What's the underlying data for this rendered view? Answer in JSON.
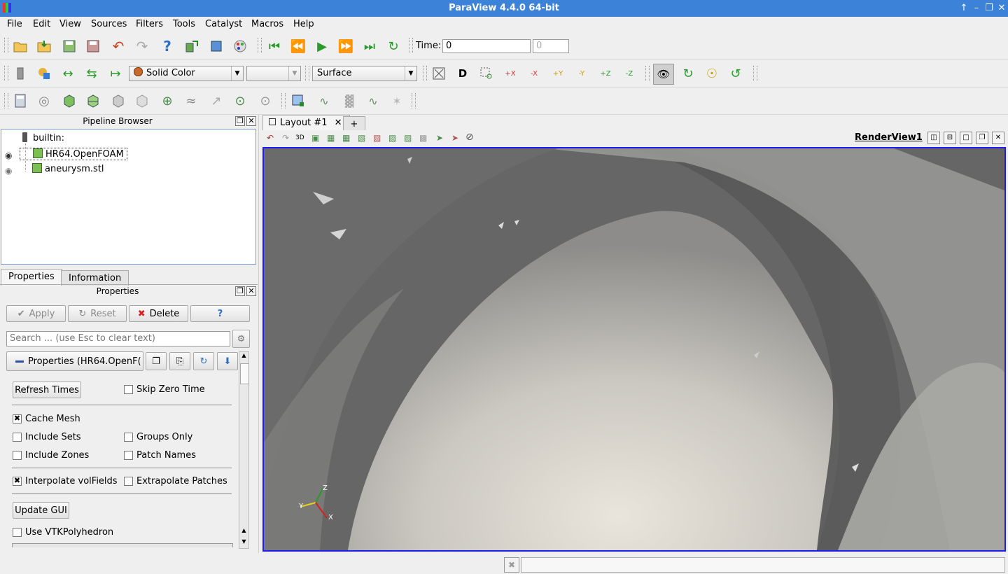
{
  "window": {
    "title": "ParaView 4.4.0 64-bit"
  },
  "menu": [
    "File",
    "Edit",
    "View",
    "Sources",
    "Filters",
    "Tools",
    "Catalyst",
    "Macros",
    "Help"
  ],
  "time": {
    "label": "Time:",
    "value": "0",
    "spin_value": "0"
  },
  "representation": {
    "color_by": "Solid Color",
    "component": "",
    "style": "Surface"
  },
  "pipeline": {
    "title": "Pipeline Browser",
    "root": "builtin:",
    "items": [
      {
        "name": "HR64.OpenFOAM",
        "visible": true,
        "selected": true
      },
      {
        "name": "aneurysm.stl",
        "visible": true,
        "selected": false
      }
    ]
  },
  "tabs_left": [
    "Properties",
    "Information"
  ],
  "properties": {
    "title": "Properties",
    "apply": "Apply",
    "reset": "Reset",
    "delete": "Delete",
    "help": "?",
    "search_placeholder": "Search ... (use Esc to clear text)",
    "section": "Properties (HR64.OpenF(",
    "refresh": "Refresh Times",
    "update_gui": "Update GUI",
    "checks": [
      {
        "label": "Skip Zero Time",
        "checked": false
      },
      {
        "label": "Cache Mesh",
        "checked": true
      },
      {
        "label": "Include Sets",
        "checked": false
      },
      {
        "label": "Groups Only",
        "checked": false
      },
      {
        "label": "Include Zones",
        "checked": false
      },
      {
        "label": "Patch Names",
        "checked": false
      },
      {
        "label": "Interpolate volFields",
        "checked": true
      },
      {
        "label": "Extrapolate Patches",
        "checked": false
      },
      {
        "label": "Use VTKPolyhedron",
        "checked": false
      }
    ]
  },
  "layout": {
    "tab": "Layout #1",
    "add": "+",
    "view_name": "RenderView1",
    "mode_3d": "3D"
  },
  "axes": {
    "z": "Z",
    "y": "Y",
    "x": "X"
  }
}
